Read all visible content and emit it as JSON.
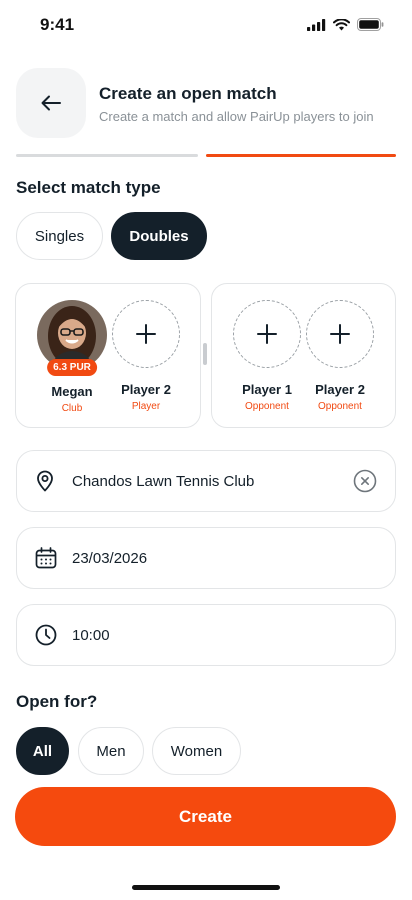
{
  "status_bar": {
    "time": "9:41"
  },
  "header": {
    "title": "Create an open match",
    "subtitle": "Create a match and allow PairUp players to join"
  },
  "progress": {
    "current_step": 2,
    "total_steps": 2
  },
  "match_type": {
    "title": "Select match type",
    "options": [
      "Singles",
      "Doubles"
    ],
    "selected": "Doubles"
  },
  "teams": {
    "team1": [
      {
        "name": "Megan",
        "role": "Club",
        "rating": "6.3 PUR"
      },
      {
        "name": "Player 2",
        "role": "Player"
      }
    ],
    "team2": [
      {
        "name": "Player 1",
        "role": "Opponent"
      },
      {
        "name": "Player 2",
        "role": "Opponent"
      }
    ]
  },
  "location": {
    "value": "Chandos Lawn Tennis Club",
    "icon": "location-pin-icon"
  },
  "date": {
    "value": "23/03/2026",
    "icon": "calendar-icon"
  },
  "time": {
    "value": "10:00",
    "icon": "clock-icon"
  },
  "open_for": {
    "title": "Open for?",
    "options": [
      "All",
      "Men",
      "Women"
    ],
    "selected": "All"
  },
  "create_label": "Create",
  "colors": {
    "accent": "#f54a0e",
    "dark": "#14202a",
    "border": "#e3e5e7"
  }
}
